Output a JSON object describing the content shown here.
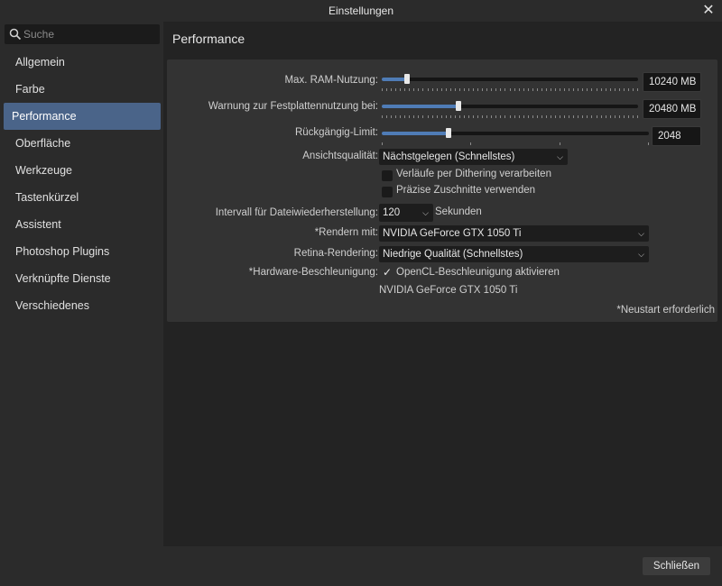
{
  "window": {
    "title": "Einstellungen"
  },
  "search": {
    "placeholder": "Suche"
  },
  "nav": {
    "items": [
      {
        "label": "Allgemein"
      },
      {
        "label": "Farbe"
      },
      {
        "label": "Performance"
      },
      {
        "label": "Oberfläche"
      },
      {
        "label": "Werkzeuge"
      },
      {
        "label": "Tastenkürzel"
      },
      {
        "label": "Assistent"
      },
      {
        "label": "Photoshop Plugins"
      },
      {
        "label": "Verknüpfte Dienste"
      },
      {
        "label": "Verschiedenes"
      }
    ],
    "active": "Performance"
  },
  "page": {
    "title": "Performance"
  },
  "settings": {
    "ram": {
      "label": "Max. RAM-Nutzung:",
      "value": "10240 MB",
      "level": 0.1
    },
    "disk_warning": {
      "label": "Warnung zur Festplattennutzung bei:",
      "value": "20480 MB",
      "level": 0.3
    },
    "undo_limit": {
      "label": "Rückgängig-Limit:",
      "value": "2048",
      "level": 0.25
    },
    "view_quality": {
      "label": "Ansichtsqualität:",
      "value": "Nächstgelegen (Schnellstes)"
    },
    "dither": {
      "label": "Verläufe per Dithering verarbeiten",
      "checked": false
    },
    "precise_clip": {
      "label": "Präzise Zuschnitte verwenden",
      "checked": false
    },
    "recovery_interval": {
      "label": "Intervall für Dateiwiederherstellung:",
      "value": "120",
      "unit": "Sekunden"
    },
    "render_with": {
      "label": "*Rendern mit:",
      "value": "NVIDIA GeForce GTX 1050 Ti"
    },
    "retina": {
      "label": "Retina-Rendering:",
      "value": "Niedrige Qualität (Schnellstes)"
    },
    "hw_accel": {
      "label": "*Hardware-Beschleunigung:",
      "checkbox_label": "OpenCL-Beschleunigung aktivieren",
      "checked": true,
      "device": "NVIDIA GeForce GTX 1050 Ti"
    },
    "restart_note": "*Neustart erforderlich"
  },
  "footer": {
    "close_label": "Schließen"
  },
  "icons": {
    "search": "search-icon",
    "close": "close-icon",
    "chevron": "chevron-down-icon",
    "check": "checkmark-icon"
  },
  "colors": {
    "accent": "#4f7cb6",
    "active_nav": "#4a6489"
  }
}
